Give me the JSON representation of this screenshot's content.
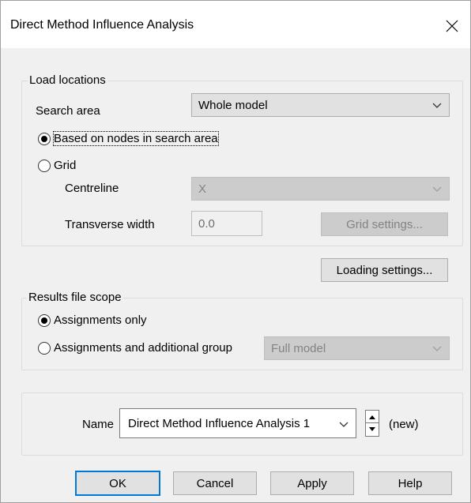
{
  "window": {
    "title": "Direct Method Influence Analysis"
  },
  "load_locations": {
    "legend": "Load locations",
    "search_area_label": "Search area",
    "search_area_value": "Whole model",
    "radio_nodes_label": "Based on nodes in search area",
    "radio_grid_label": "Grid",
    "selected": "nodes",
    "centreline_label": "Centreline",
    "centreline_value": "X",
    "transverse_width_label": "Transverse width",
    "transverse_width_value": "0.0",
    "grid_settings_label": "Grid settings..."
  },
  "loading_settings_label": "Loading settings...",
  "results_scope": {
    "legend": "Results file scope",
    "radio_assignments_label": "Assignments only",
    "radio_additional_label": "Assignments and additional group",
    "selected": "assignments",
    "group_value": "Full model"
  },
  "name_section": {
    "label": "Name",
    "value": "Direct Method Influence Analysis 1",
    "status": "(new)"
  },
  "buttons": {
    "ok": "OK",
    "cancel": "Cancel",
    "apply": "Apply",
    "help": "Help"
  }
}
